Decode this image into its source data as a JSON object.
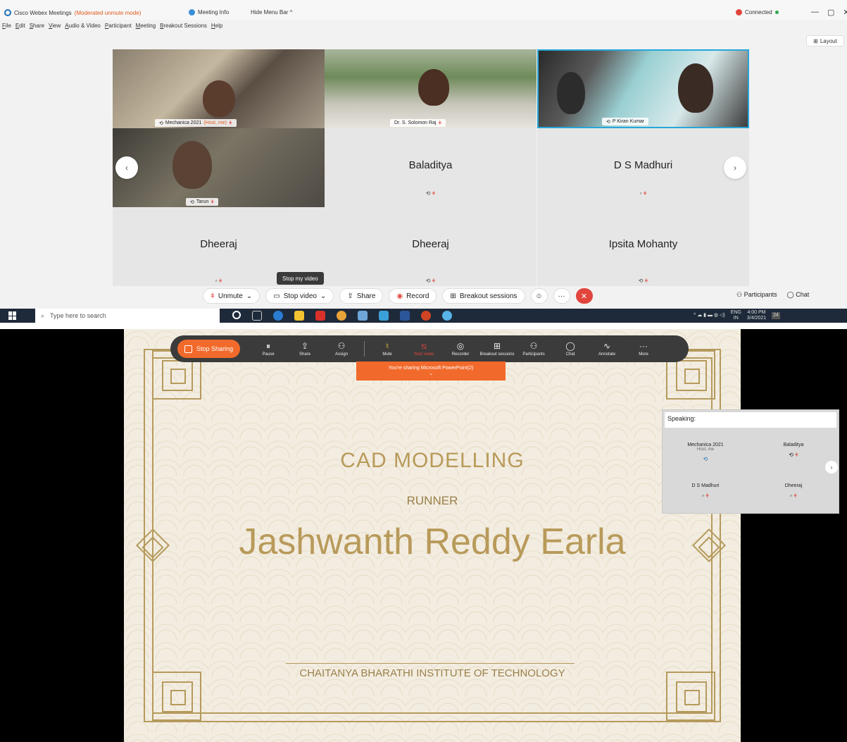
{
  "titlebar": {
    "app": "Cisco Webex Meetings",
    "mode": "(Moderated unmute mode)",
    "meeting_info": "Meeting Info",
    "hide_menu": "Hide Menu Bar ^",
    "connected": "Connected",
    "controls": [
      "—",
      "▢",
      "✕"
    ]
  },
  "menu": [
    "File",
    "Edit",
    "Share",
    "View",
    "Audio & Video",
    "Participant",
    "Meeting",
    "Breakout Sessions",
    "Help"
  ],
  "layout_label": "Layout",
  "tiles": [
    {
      "name": "Mechanica 2021",
      "host": "(Host, me)",
      "video": true
    },
    {
      "name": "Dr. S. Solomon Raj",
      "video": true
    },
    {
      "name": "P Kiran Kumar",
      "video": true
    },
    {
      "name": "Tarun",
      "video": true
    },
    {
      "name": "Baladitya",
      "video": false
    },
    {
      "name": "D S Madhuri",
      "video": false
    },
    {
      "name": "Dheeraj",
      "video": false
    },
    {
      "name": "Dheeraj",
      "video": false
    },
    {
      "name": "Ipsita Mohanty",
      "video": false
    }
  ],
  "tooltip": "Stop my video",
  "controls": {
    "unmute": "Unmute",
    "stop_video": "Stop video",
    "share": "Share",
    "record": "Record",
    "breakout": "Breakout sessions",
    "participants": "Participants",
    "chat": "Chat"
  },
  "taskbar": {
    "search_placeholder": "Type here to search",
    "lang": "ENG",
    "region": "IN",
    "time": "4:00 PM",
    "date": "3/4/2021",
    "badge": "24"
  },
  "sharebar": {
    "stop_sharing": "Stop Sharing",
    "buttons": [
      {
        "icon": "pause-icon",
        "label": "Pause"
      },
      {
        "icon": "share-icon",
        "label": "Share"
      },
      {
        "icon": "assign-icon",
        "label": "Assign"
      },
      {
        "icon": "mute-icon",
        "label": "Mute"
      },
      {
        "icon": "start-video-icon",
        "label": "Start video"
      },
      {
        "icon": "recorder-icon",
        "label": "Recorder"
      },
      {
        "icon": "breakout-icon",
        "label": "Breakout sessions"
      },
      {
        "icon": "participants-icon",
        "label": "Participants"
      },
      {
        "icon": "chat-icon",
        "label": "Chat"
      },
      {
        "icon": "annotate-icon",
        "label": "Annotate"
      },
      {
        "icon": "more-icon",
        "label": "More"
      }
    ],
    "banner": "You're sharing Microsoft PowerPoint(2)"
  },
  "slide": {
    "title": "CAD MODELLING",
    "subtitle": "RUNNER",
    "name": "Jashwanth Reddy Earla",
    "institution": "CHAITANYA BHARATHI INSTITUTE OF TECHNOLOGY"
  },
  "speaking": {
    "header": "Speaking:",
    "cells": [
      {
        "name": "Mechanica 2021",
        "sub": "Host, me"
      },
      {
        "name": "Baladitya"
      },
      {
        "name": "D S Madhuri"
      },
      {
        "name": "Dheeraj"
      }
    ]
  },
  "colors": {
    "accent_orange": "#f26a2b",
    "mute_red": "#e2453c",
    "webex_blue": "#1d6fb8",
    "slide_gold": "#b89a5a"
  }
}
